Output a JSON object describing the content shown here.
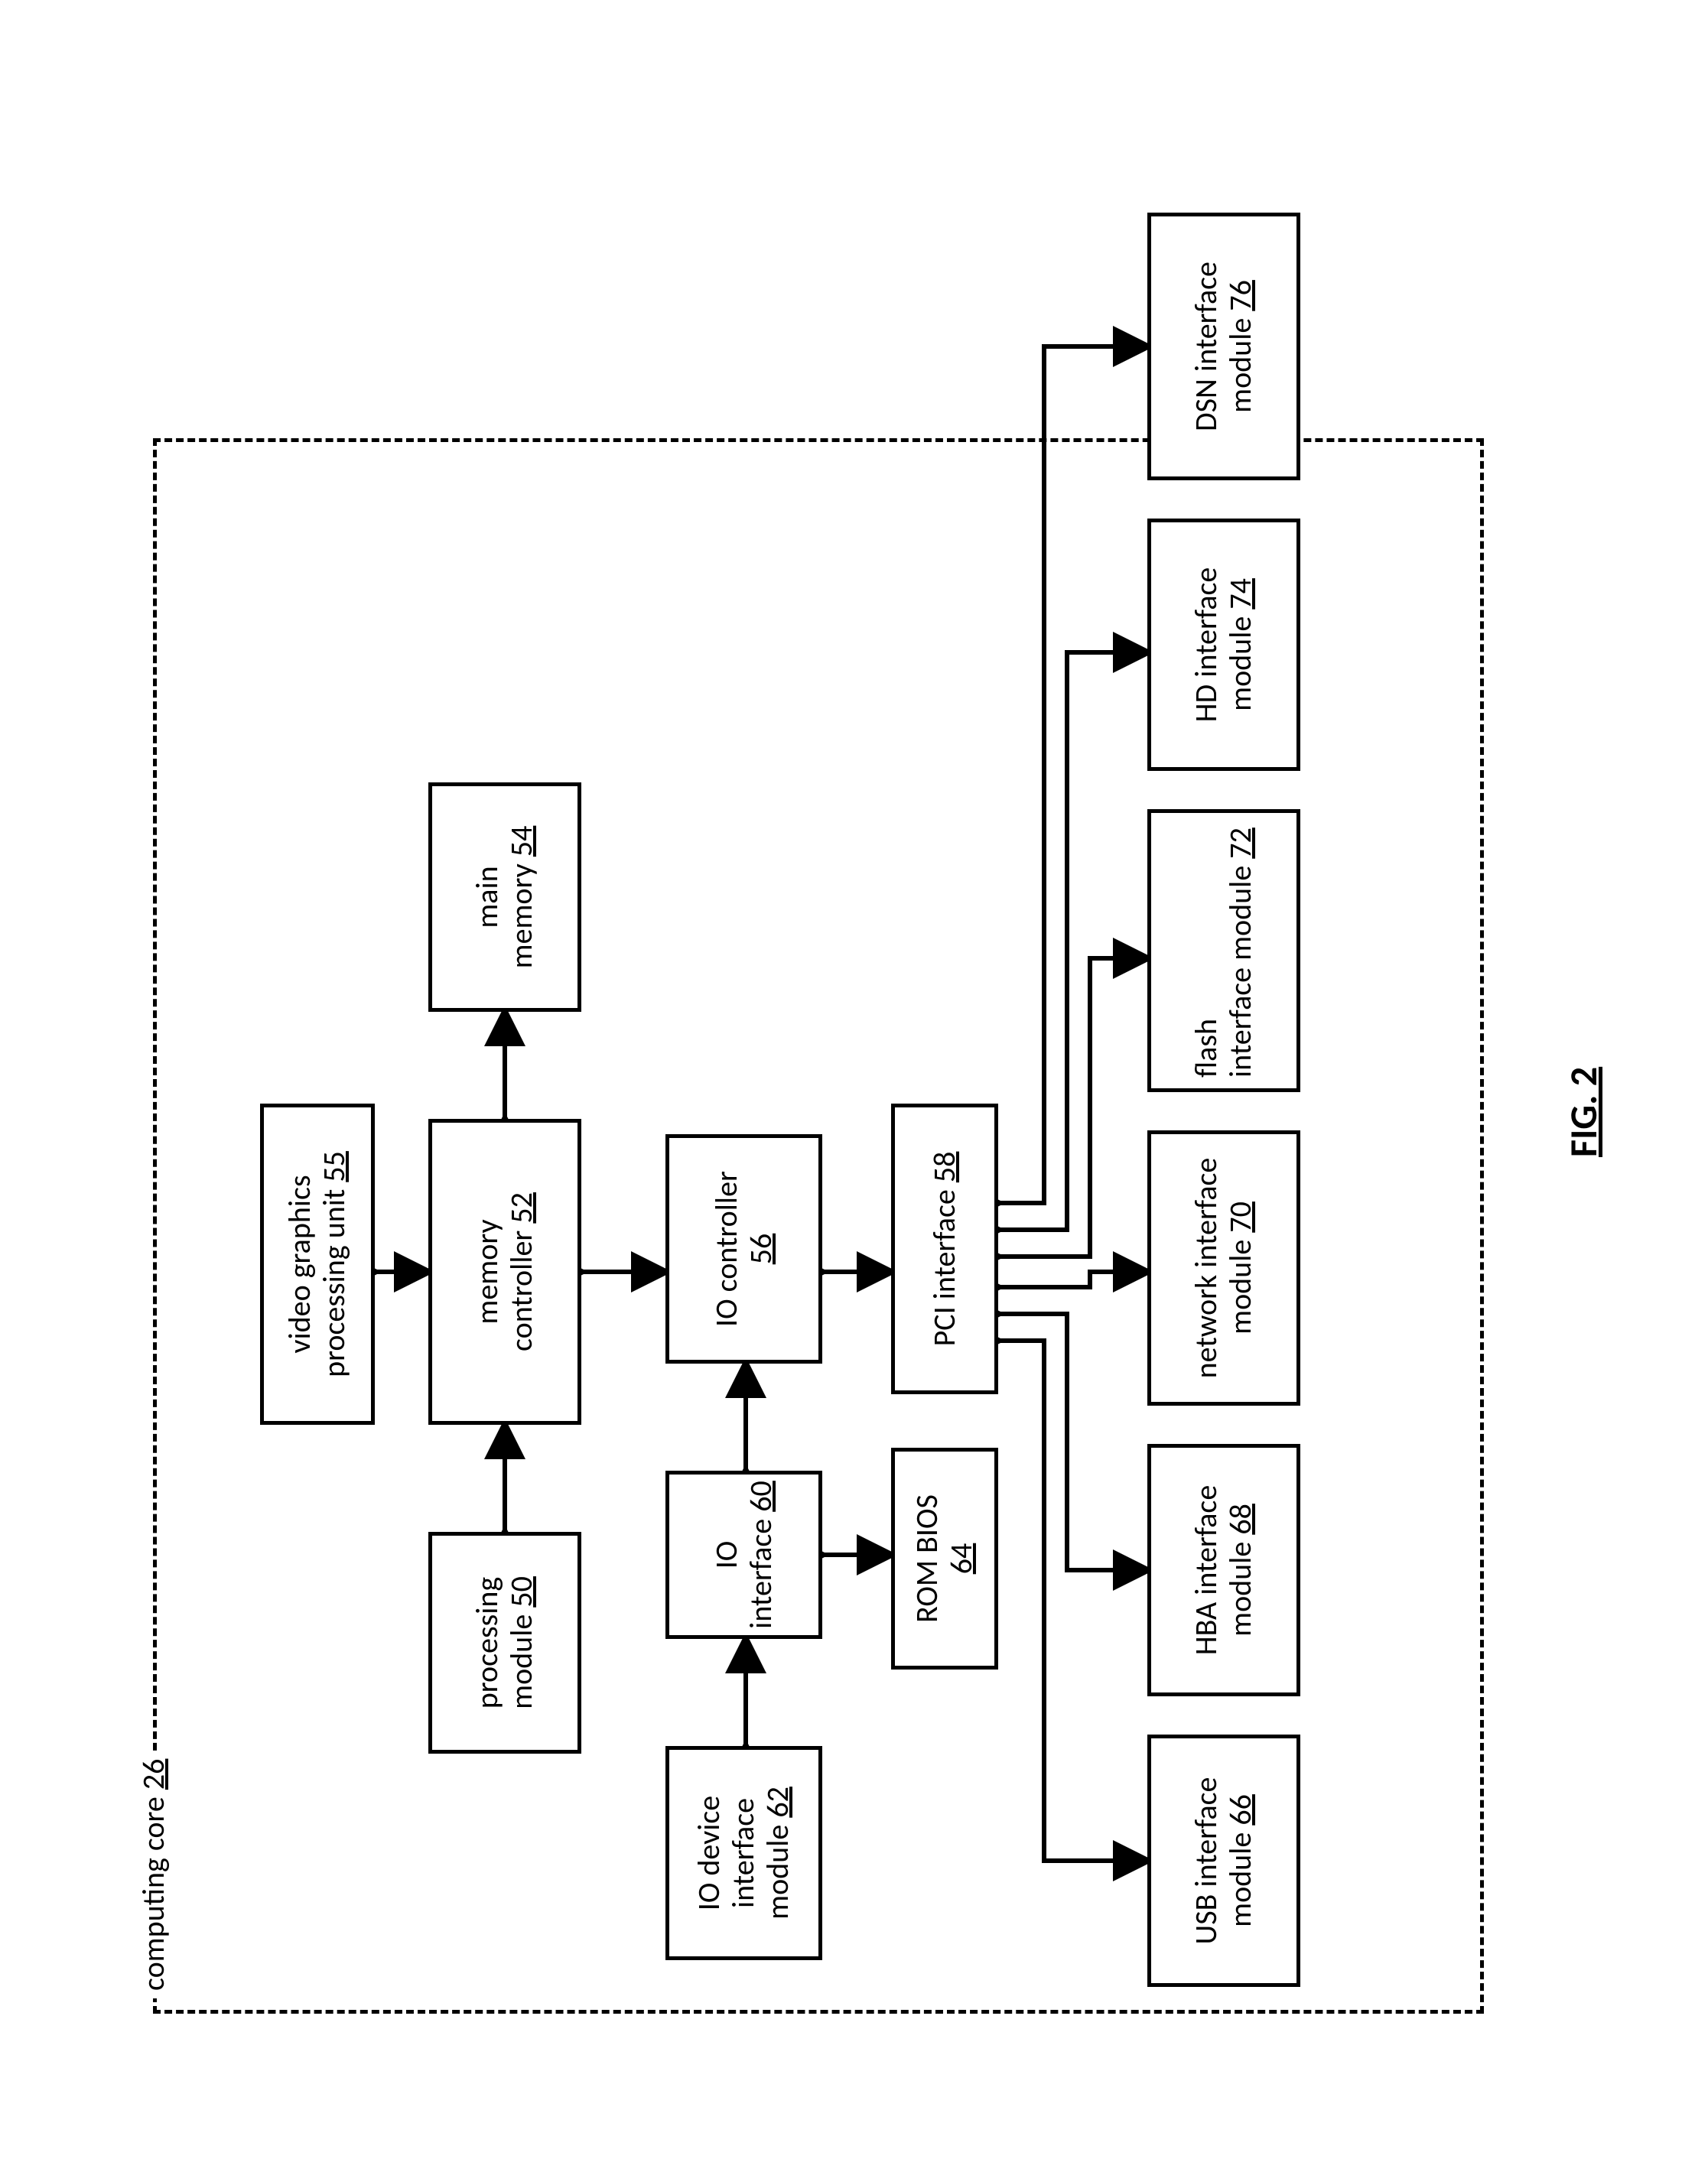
{
  "figure_caption": "FIG. 2",
  "frame": {
    "label_prefix": "computing core ",
    "label_num": "26"
  },
  "boxes": {
    "vgp": {
      "l1": "video graphics",
      "l2_prefix": "processing unit ",
      "l2_num": "55"
    },
    "proc": {
      "l1": "processing",
      "l2_prefix": "module ",
      "l2_num": "50"
    },
    "memctrl": {
      "l1_prefix": "memory",
      "l2_prefix": "controller ",
      "l2_num": "52"
    },
    "mainmem": {
      "l1": "main",
      "l2_prefix": "memory ",
      "l2_num": "54"
    },
    "iodev": {
      "l1": "IO device",
      "l2": "interface",
      "l3_prefix": "module ",
      "l3_num": "62"
    },
    "ioif": {
      "l1": "IO",
      "l2_prefix": "interface ",
      "l2_num": "60"
    },
    "ioctrl": {
      "l1": "IO controller",
      "l2_num": "56"
    },
    "rombios": {
      "l1": "ROM BIOS",
      "l2_num": "64"
    },
    "pci": {
      "l1_prefix": "PCI interface ",
      "l1_num": "58"
    },
    "usb": {
      "l1": "USB interface",
      "l2_prefix": "module ",
      "l2_num": "66"
    },
    "hba": {
      "l1": "HBA interface",
      "l2_prefix": "module ",
      "l2_num": "68"
    },
    "net": {
      "l1": "network interface",
      "l2_prefix": "module ",
      "l2_num": "70"
    },
    "flash": {
      "l1": "flash",
      "l2_prefix": "interface module ",
      "l2_num": "72"
    },
    "hd": {
      "l1": "HD interface",
      "l2_prefix": "module ",
      "l2_num": "74"
    },
    "dsn": {
      "l1": "DSN interface",
      "l2_prefix": "module ",
      "l2_num": "76"
    }
  }
}
